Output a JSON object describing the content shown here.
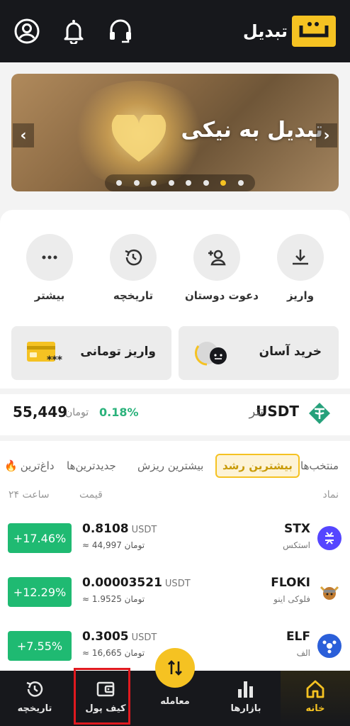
{
  "header": {
    "logo_text": "تبدیل",
    "brand_color": "#f5c222",
    "icons": [
      "profile-icon",
      "bell-icon",
      "headset-icon"
    ]
  },
  "banner": {
    "title": "تبدیل به نیکی",
    "slides_total": 8,
    "active_slide": 7
  },
  "quick_actions": [
    {
      "label": "واریز",
      "icon": "download-icon"
    },
    {
      "label": "دعوت دوستان",
      "icon": "add-user-icon"
    },
    {
      "label": "تاریخچه",
      "icon": "history-icon"
    },
    {
      "label": "بیشتر",
      "icon": "more-icon"
    }
  ],
  "cards": {
    "easy_buy": "خرید آسان",
    "toman_deposit": "واریز تومانی"
  },
  "usdt": {
    "symbol": "USDT",
    "name": "تتر",
    "change": "0.18%",
    "unit": "تومان",
    "price": "55,449"
  },
  "tabs": {
    "favorites": "منتخب‌ها",
    "top_gainers": "بیشترین رشد",
    "top_losers": "بیشترین ریزش",
    "newest": "جدیدترین‌ها",
    "hot": "داغ‌ترین"
  },
  "columns": {
    "symbol": "نماد",
    "price": "قیمت",
    "change_24h": "۲۴ ساعت"
  },
  "markets": [
    {
      "symbol": "STX",
      "name": "استکس",
      "price": "0.8108",
      "unit": "USDT",
      "toman": "≈ 44,997 تومان",
      "change": "+17.46%"
    },
    {
      "symbol": "FLOKI",
      "name": "فلوکی اینو",
      "price": "0.00003521",
      "unit": "USDT",
      "toman": "≈ 1.9525 تومان",
      "change": "+12.29%"
    },
    {
      "symbol": "ELF",
      "name": "الف",
      "price": "0.3005",
      "unit": "USDT",
      "toman": "≈ 16,665 تومان",
      "change": "+7.55%"
    }
  ],
  "nav": {
    "home": "خانه",
    "markets": "بازارها",
    "trade": "معامله",
    "wallet": "کیف پول",
    "history": "تاریخچه"
  }
}
